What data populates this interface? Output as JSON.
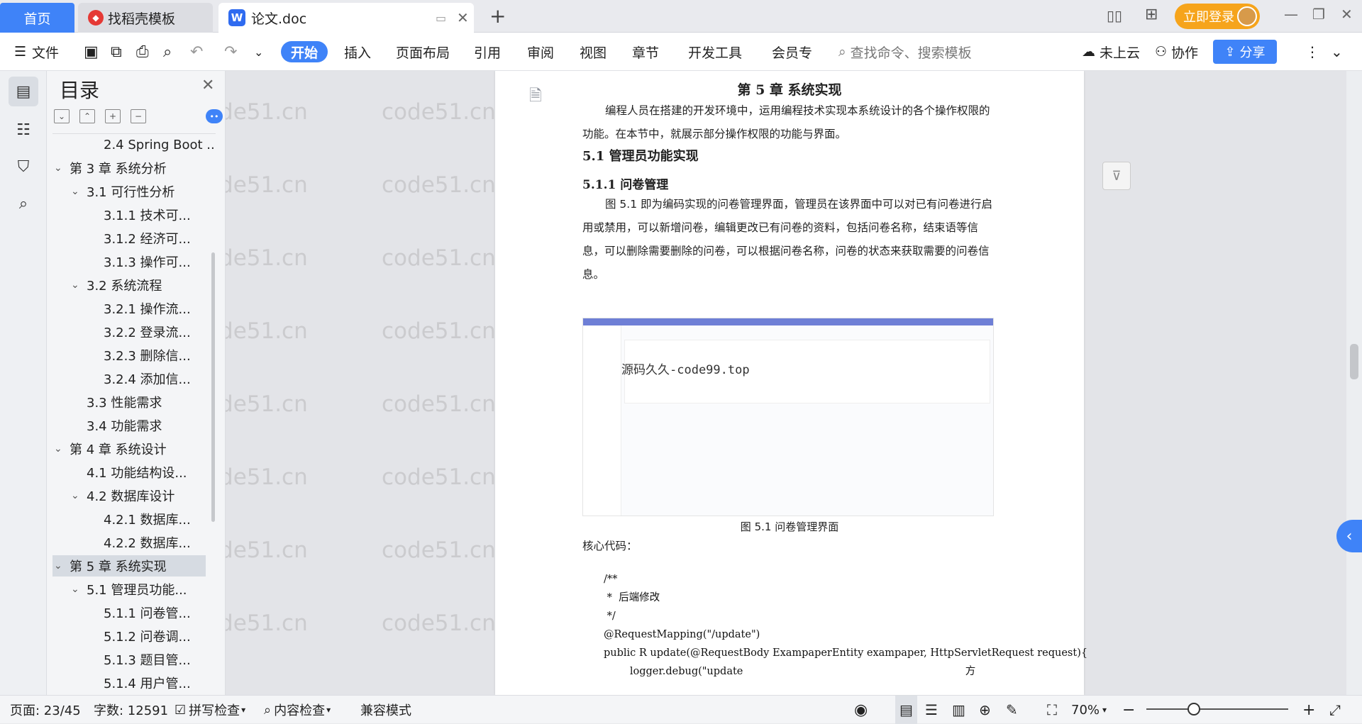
{
  "tabs": {
    "home": "首页",
    "template": "找稻壳模板",
    "doc": "论文.doc"
  },
  "titlebar": {
    "login": "立即登录"
  },
  "ribbon": {
    "file": "文件",
    "menus": [
      "开始",
      "插入",
      "页面布局",
      "引用",
      "审阅",
      "视图",
      "章节",
      "开发工具",
      "会员专"
    ],
    "search_placeholder": "查找命令、搜索模板",
    "cloud": "未上云",
    "collab": "协作",
    "share": "分享"
  },
  "toc": {
    "title": "目录",
    "items": [
      {
        "label": "2.4 Spring Boot ...",
        "level": 2,
        "expand": ""
      },
      {
        "label": "第 3 章  系统分析",
        "level": 0,
        "expand": "v"
      },
      {
        "label": "3.1  可行性分析",
        "level": 1,
        "expand": "v"
      },
      {
        "label": "3.1.1  技术可...",
        "level": 2,
        "expand": ""
      },
      {
        "label": "3.1.2  经济可...",
        "level": 2,
        "expand": ""
      },
      {
        "label": "3.1.3  操作可...",
        "level": 2,
        "expand": ""
      },
      {
        "label": "3.2  系统流程",
        "level": 1,
        "expand": "v"
      },
      {
        "label": "3.2.1  操作流...",
        "level": 2,
        "expand": ""
      },
      {
        "label": "3.2.2  登录流...",
        "level": 2,
        "expand": ""
      },
      {
        "label": "3.2.3  删除信...",
        "level": 2,
        "expand": ""
      },
      {
        "label": "3.2.4  添加信...",
        "level": 2,
        "expand": ""
      },
      {
        "label": "3.3  性能需求",
        "level": 1,
        "expand": ""
      },
      {
        "label": "3.4  功能需求",
        "level": 1,
        "expand": ""
      },
      {
        "label": "第 4 章  系统设计",
        "level": 0,
        "expand": "v"
      },
      {
        "label": "4.1  功能结构设...",
        "level": 1,
        "expand": ""
      },
      {
        "label": "4.2  数据库设计",
        "level": 1,
        "expand": "v"
      },
      {
        "label": "4.2.1  数据库...",
        "level": 2,
        "expand": ""
      },
      {
        "label": "4.2.2  数据库...",
        "level": 2,
        "expand": ""
      },
      {
        "label": "第 5 章  系统实现",
        "level": 0,
        "expand": "v",
        "active": true
      },
      {
        "label": "5.1  管理员功能...",
        "level": 1,
        "expand": "v"
      },
      {
        "label": "5.1.1  问卷管...",
        "level": 2,
        "expand": ""
      },
      {
        "label": "5.1.2  问卷调...",
        "level": 2,
        "expand": ""
      },
      {
        "label": "5.1.3  题目管...",
        "level": 2,
        "expand": ""
      },
      {
        "label": "5.1.4  用户管...",
        "level": 2,
        "expand": ""
      }
    ]
  },
  "doc": {
    "chapter": "第 5 章  系统实现",
    "intro": "编程人员在搭建的开发环境中，运用编程技术实现本系统设计的各个操作权限的功能。在本节中，就展示部分操作权限的功能与界面。",
    "h51": "5.1  管理员功能实现",
    "h511": "5.1.1  问卷管理",
    "para511": "图 5.1  即为编码实现的问卷管理界面，管理员在该界面中可以对已有问卷进行启用或禁用，可以新增问卷，编辑更改已有问卷的资料，包括问卷名称，结束语等信息，可以删除需要删除的问卷，可以根据问卷名称，问卷的状态来获取需要的问卷信息。",
    "figure_watermark": "源码久久-code99.top",
    "caption": "图 5.1  问卷管理界面",
    "code_label": "核心代码：",
    "code_lines": [
      "/**",
      " *  后端修改",
      " */",
      "@RequestMapping(\"/update\")",
      "public R update(@RequestBody ExampaperEntity exampaper, HttpServletRequest request){",
      "        logger.debug(\"update                                                                    方"
    ]
  },
  "watermark": "code51.cn",
  "status": {
    "page": "页面: 23/45",
    "words": "字数: 12591",
    "spell": "拼写检查",
    "content": "内容检查",
    "compat": "兼容模式",
    "zoom": "70%"
  }
}
